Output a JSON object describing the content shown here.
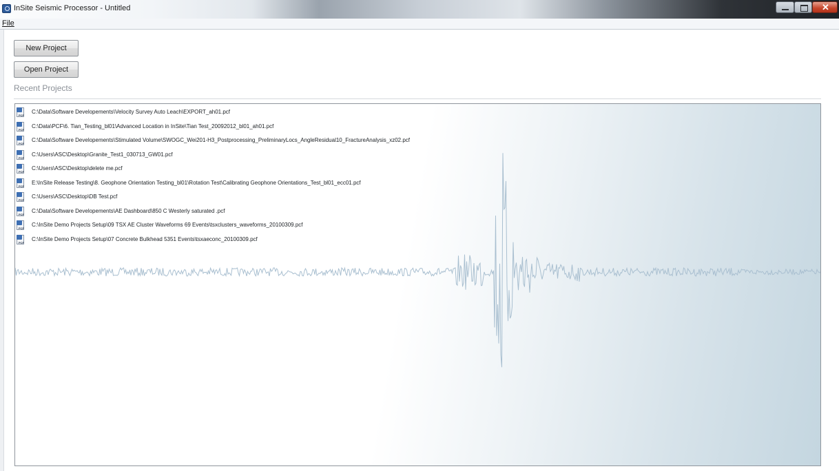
{
  "window": {
    "title": "InSite Seismic Processor - Untitled"
  },
  "menu": {
    "file": "File"
  },
  "actions": {
    "new_project": "New Project",
    "open_project": "Open Project"
  },
  "recent": {
    "heading": "Recent Projects",
    "items": [
      "C:\\Data\\Software Developements\\Velocity Survey Auto Leach\\EXPORT_ah01.pcf",
      "C:\\Data\\PCF\\6. Tian_Testing_bl01\\Advanced Location in InSite\\Tian Test_20092012_bl01_ah01.pcf",
      "C:\\Data\\Software Developements\\Stimulated Volume\\SWOGC_Wei201-H3_Postprocessing_PreliminaryLocs_AngleResidual10_FractureAnalysis_xz02.pcf",
      "C:\\Users\\ASC\\Desktop\\Granite_Test1_030713_GW01.pcf",
      "C:\\Users\\ASC\\Desktop\\delete me.pcf",
      "E:\\InSite Release Testing\\8. Geophone Orientation Testing_bl01\\Rotation Test\\Calibrating Geophone Orientations_Test_bl01_ecc01.pcf",
      "C:\\Users\\ASC\\Desktop\\DB Test.pcf",
      "C:\\Data\\Software Developements\\AE Dashboard\\850 C Westerly saturated .pcf",
      "C:\\InSite Demo Projects Setup\\09 TSX AE Cluster Waveforms 69 Events\\tsxclusters_waveforms_20100309.pcf",
      "C:\\InSite Demo Projects Setup\\07 Concrete Bulkhead 5351 Events\\tsxaeconc_20100309.pcf"
    ],
    "file_icon_label": "PCF"
  },
  "colors": {
    "waveform": "#a9bfd0",
    "panel_border": "#8f959c",
    "heading": "#8b9097"
  },
  "icons": {
    "app": "seismic-app-icon",
    "file": "pcf-file-icon"
  }
}
